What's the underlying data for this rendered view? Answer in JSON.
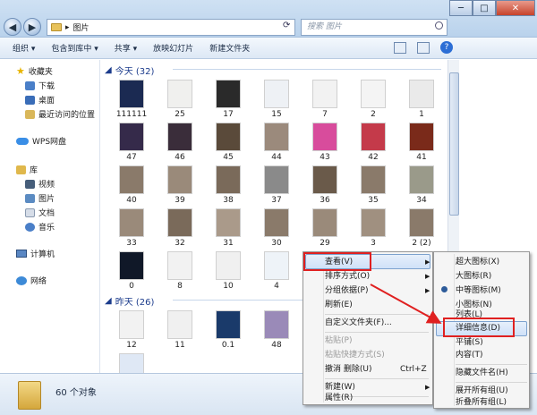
{
  "window": {
    "address": "图片",
    "search_placeholder": "搜索 图片",
    "minimize": "─",
    "maximize": "□",
    "close": "✕"
  },
  "toolbar": {
    "organize": "组织 ▾",
    "include": "包含到库中 ▾",
    "share": "共享 ▾",
    "slideshow": "放映幻灯片",
    "new_folder": "新建文件夹"
  },
  "sidebar": {
    "favorites": "收藏夹",
    "downloads": "下载",
    "desktop": "桌面",
    "recent": "最近访问的位置",
    "wps": "WPS网盘",
    "library": "库",
    "videos": "视频",
    "pictures": "图片",
    "documents": "文档",
    "music": "音乐",
    "computer": "计算机",
    "network": "网络"
  },
  "groups": {
    "today": "今天 (32)",
    "yesterday": "昨天 (26)"
  },
  "today_items": [
    {
      "label": "111111",
      "color": "#1b2a52"
    },
    {
      "label": "25",
      "color": "#f0f0ee"
    },
    {
      "label": "17",
      "color": "#2a2a2a"
    },
    {
      "label": "15",
      "color": "#eef1f5"
    },
    {
      "label": "7",
      "color": "#f2f2f2"
    },
    {
      "label": "2",
      "color": "#f4f4f4"
    },
    {
      "label": "1",
      "color": "#eaeaea"
    },
    {
      "label": "47",
      "color": "#352a4a"
    },
    {
      "label": "46",
      "color": "#3a2d3a"
    },
    {
      "label": "45",
      "color": "#5a4a3a"
    },
    {
      "label": "44",
      "color": "#9b8a7c"
    },
    {
      "label": "43",
      "color": "#d84c9c"
    },
    {
      "label": "42",
      "color": "#c43a4a"
    },
    {
      "label": "41",
      "color": "#7a2a1a"
    },
    {
      "label": "40",
      "color": "#8a7a6a"
    },
    {
      "label": "39",
      "color": "#9a8a7a"
    },
    {
      "label": "38",
      "color": "#7a6a5a"
    },
    {
      "label": "37",
      "color": "#8a8a8a"
    },
    {
      "label": "36",
      "color": "#6a5a4a"
    },
    {
      "label": "35",
      "color": "#8a7a6a"
    },
    {
      "label": "34",
      "color": "#9a9a8a"
    },
    {
      "label": "33",
      "color": "#9a8a7a"
    },
    {
      "label": "32",
      "color": "#7a6a5a"
    },
    {
      "label": "31",
      "color": "#aa9a8a"
    },
    {
      "label": "30",
      "color": "#8a7a6a"
    },
    {
      "label": "29",
      "color": "#9a8a7a"
    },
    {
      "label": "3",
      "color": "#a09080"
    },
    {
      "label": "2 (2)",
      "color": "#8a7a6a"
    },
    {
      "label": "0",
      "color": "#101828"
    },
    {
      "label": "8",
      "color": "#f2f2f2"
    },
    {
      "label": "10",
      "color": "#f0f0f0"
    },
    {
      "label": "4",
      "color": "#eef3f8"
    }
  ],
  "yesterday_items": [
    {
      "label": "12",
      "color": "#f2f2f2"
    },
    {
      "label": "11",
      "color": "#f0f0f0"
    },
    {
      "label": "0.1",
      "color": "#1a3a6a"
    },
    {
      "label": "48",
      "color": "#9a8ab8"
    },
    {
      "label": "",
      "color": "#f2f2f2"
    },
    {
      "label": "",
      "color": "#eeeeee"
    },
    {
      "label": "",
      "color": "#f0f0f0"
    },
    {
      "label": "",
      "color": "#dfe8f5"
    }
  ],
  "context_menu": {
    "view": "查看(V)",
    "sort": "排序方式(O)",
    "group": "分组依据(P)",
    "refresh": "刷新(E)",
    "customize": "自定义文件夹(F)...",
    "paste": "粘贴(P)",
    "paste_shortcut": "粘贴快捷方式(S)",
    "undo_delete": "撤消 删除(U)",
    "undo_shortcut": "Ctrl+Z",
    "new": "新建(W)",
    "properties": "属性(R)"
  },
  "view_submenu": {
    "xl_icons": "超大图标(X)",
    "large_icons": "大图标(R)",
    "medium_icons": "中等图标(M)",
    "small_icons": "小图标(N)",
    "list": "列表(L)",
    "details": "详细信息(D)",
    "tiles": "平铺(S)",
    "content": "内容(T)",
    "hide_names": "隐藏文件名(H)",
    "expand_groups": "展开所有组(U)",
    "collapse_groups": "折叠所有组(L)"
  },
  "status": {
    "count": "60 个对象"
  },
  "colors": {
    "highlight_box": "#e02020",
    "group_header": "#1c3c8c"
  }
}
